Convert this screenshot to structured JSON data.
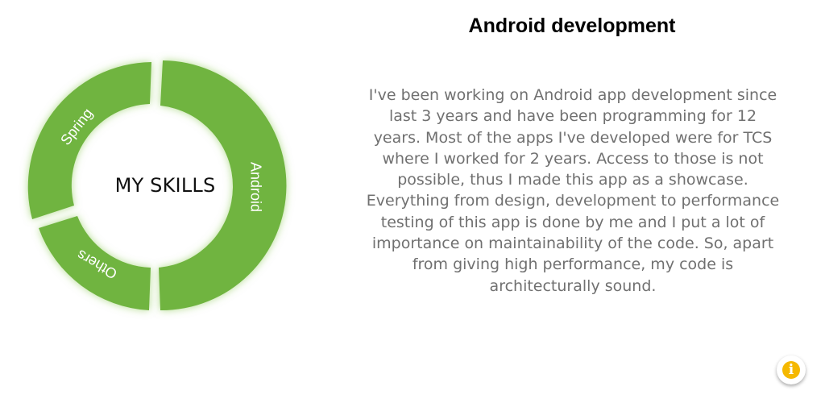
{
  "skills_wheel": {
    "center_label": "MY SKILLS",
    "segments": [
      {
        "label": "Android",
        "color": "#6fb43f"
      },
      {
        "label": "Others",
        "color": "#6fb43f"
      },
      {
        "label": "Spring",
        "color": "#6fb43f"
      }
    ]
  },
  "detail": {
    "title": "Android development",
    "description": "I've been working on Android app development since last 3 years and have been programming for 12 years. Most of the apps I've developed were for TCS where I worked for 2 years. Access to those is not possible, thus I made this app as a showcase. Everything from design, development to performance testing of this app is done by me and I put a lot of importance on maintainability of the code. So, apart from giving high performance, my code is architecturally sound."
  },
  "info_button": {
    "icon": "info-icon",
    "glyph": "i",
    "color": "#f5b800"
  }
}
